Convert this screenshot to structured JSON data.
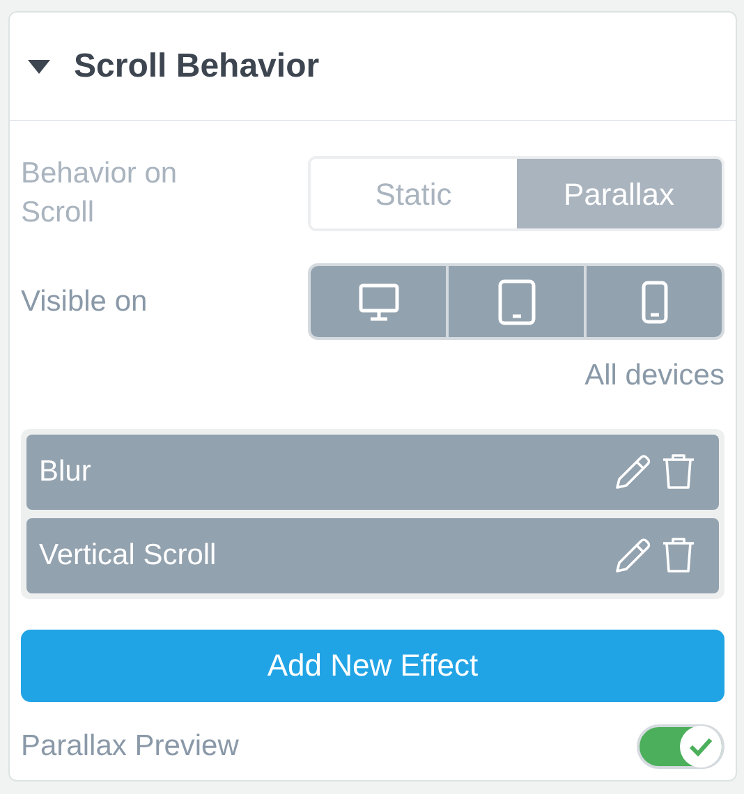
{
  "section": {
    "title": "Scroll Behavior",
    "expanded": true
  },
  "behavior": {
    "label": "Behavior on Scroll",
    "disabled": true,
    "options": [
      {
        "label": "Static",
        "selected": false
      },
      {
        "label": "Parallax",
        "selected": true
      }
    ]
  },
  "visibility": {
    "label": "Visible on",
    "devices": [
      {
        "kind": "desktop",
        "selected": true
      },
      {
        "kind": "tablet",
        "selected": true
      },
      {
        "kind": "phone",
        "selected": true
      }
    ],
    "summary": "All devices"
  },
  "effects": [
    {
      "name": "Blur"
    },
    {
      "name": "Vertical Scroll"
    }
  ],
  "add_button": "Add New Effect",
  "preview": {
    "label": "Parallax Preview",
    "on": true
  }
}
